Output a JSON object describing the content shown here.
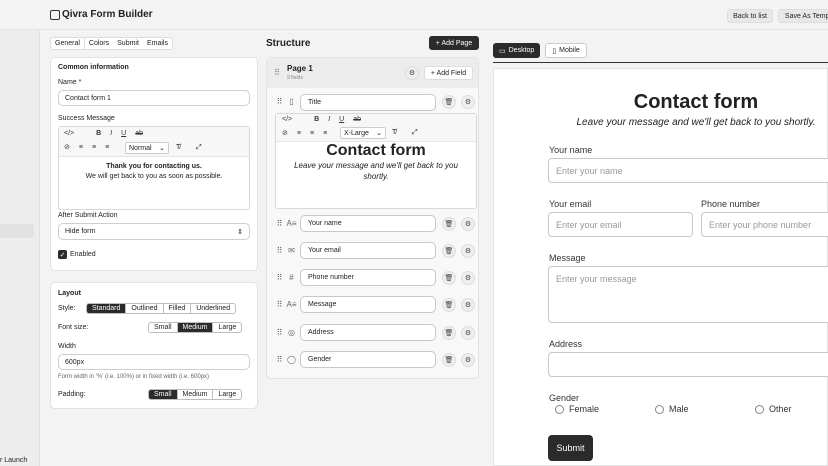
{
  "app": {
    "title": "Qivra Form Builder",
    "left_footer": "r Launch"
  },
  "header": {
    "back_label": "Back to list",
    "save_template_label": "Save As Templ"
  },
  "settings": {
    "tabs": [
      "General",
      "Colors",
      "Submit",
      "Emails"
    ],
    "common": {
      "heading": "Common information",
      "name_label": "Name *",
      "name_value": "Contact form 1",
      "success_label": "Success Message",
      "toolbar_heading": "Normal",
      "success_line1": "Thank you for contacting us.",
      "success_line2": "We will get back to you as soon as possible.",
      "after_submit_label": "After Submit Action",
      "after_submit_value": "Hide form",
      "enabled_label": "Enabled",
      "enabled_checked": true
    },
    "layout": {
      "heading": "Layout",
      "style_label": "Style:",
      "styles": [
        "Standard",
        "Outlined",
        "Filled",
        "Underlined"
      ],
      "style_selected": "Standard",
      "font_label": "Font size:",
      "fonts": [
        "Small",
        "Medium",
        "Large"
      ],
      "font_selected": "Medium",
      "width_label": "Width",
      "width_value": "600px",
      "width_help": "Form width in '%' (i.e. 100%) or in fixed width (i.e. 600px)",
      "padding_label": "Padding:",
      "paddings": [
        "Small",
        "Medium",
        "Large"
      ],
      "padding_selected": "Small"
    }
  },
  "structure": {
    "heading": "Structure",
    "add_page_label": "+ Add Page",
    "page_title": "Page 1",
    "page_count": "9 fields",
    "add_field_label": "+ Add Field",
    "title_field": "Title",
    "title_heading_size": "X-Large",
    "editor_title": "Contact form",
    "editor_subtitle": "Leave your message and we'll get back to you shortly.",
    "fields": [
      {
        "label": "Your name",
        "icon": "text-icon"
      },
      {
        "label": "Your email",
        "icon": "mail-icon"
      },
      {
        "label": "Phone number",
        "icon": "hash-icon"
      },
      {
        "label": "Message",
        "icon": "text-icon"
      },
      {
        "label": "Address",
        "icon": "map-icon"
      },
      {
        "label": "Gender",
        "icon": "radio-icon"
      }
    ]
  },
  "preview": {
    "tabs": [
      "Desktop",
      "Mobile"
    ],
    "title": "Contact form",
    "subtitle": "Leave your message and we'll get back to you shortly.",
    "name_label": "Your name",
    "name_placeholder": "Enter your name",
    "email_label": "Your email",
    "email_placeholder": "Enter your email",
    "phone_label": "Phone number",
    "phone_placeholder": "Enter your phone number",
    "message_label": "Message",
    "message_placeholder": "Enter your message",
    "address_label": "Address",
    "gender_label": "Gender",
    "gender_options": [
      "Female",
      "Male",
      "Other"
    ],
    "submit_label": "Submit"
  }
}
